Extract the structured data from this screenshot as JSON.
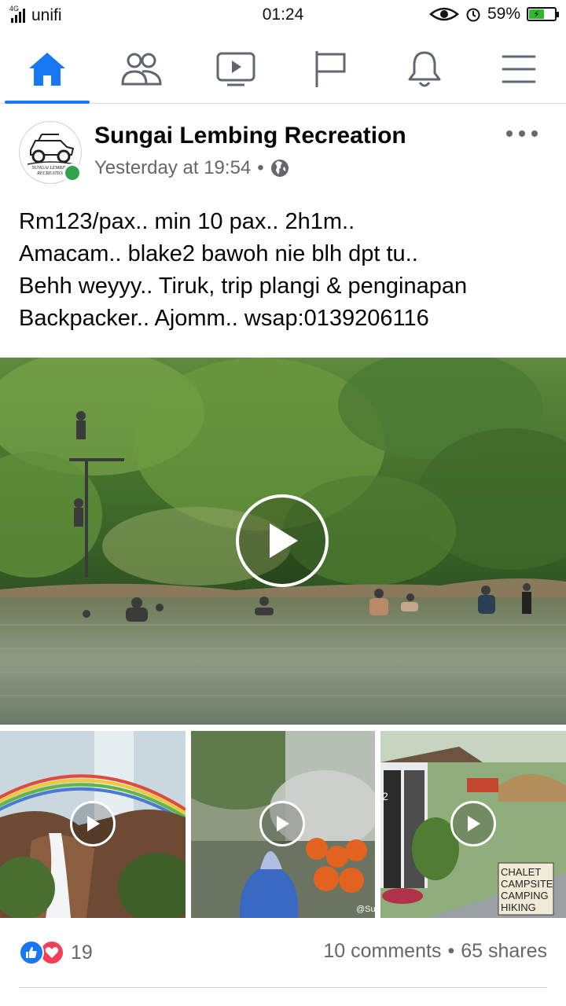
{
  "status_bar": {
    "network_type": "4G",
    "carrier": "unifi",
    "time": "01:24",
    "battery_percent": "59%",
    "battery_level": 0.59
  },
  "nav": {
    "tabs": [
      {
        "icon": "home-icon",
        "active": true
      },
      {
        "icon": "friends-icon",
        "active": false
      },
      {
        "icon": "watch-icon",
        "active": false
      },
      {
        "icon": "pages-flag-icon",
        "active": false
      },
      {
        "icon": "notifications-bell-icon",
        "active": false
      },
      {
        "icon": "menu-icon",
        "active": false
      }
    ],
    "accent_color": "#1877f2"
  },
  "post": {
    "page_name": "Sungai Lembing Recreation",
    "timestamp": "Yesterday at 19:54",
    "separator": "•",
    "privacy_icon": "globe-icon",
    "avatar_logo_text": "SUNGAI LEMBING RECREATION",
    "text_lines": [
      "Rm123/pax.. min 10 pax.. 2h1m..",
      "Amacam.. blake2 bawoh nie blh dpt tu..",
      "Behh weyyy.. Tiruk, trip plangi & penginapan",
      "Backpacker.. Ajomm.. wsap:0139206116"
    ],
    "media": {
      "main_video": {
        "description_icon": "play-icon"
      },
      "thumbnails": [
        {
          "icon": "play-icon",
          "watermark": ""
        },
        {
          "icon": "play-icon",
          "watermark": "@Sun"
        },
        {
          "icon": "play-icon",
          "sign_lines": [
            "CHALET",
            "CAMPSITE",
            "CAMPING",
            "HIKING"
          ],
          "room_number": "2"
        }
      ]
    },
    "reactions": {
      "icons": [
        "like-icon",
        "love-icon"
      ],
      "count": "19",
      "comments": "10 comments",
      "dot": "•",
      "shares": "65 shares"
    }
  }
}
